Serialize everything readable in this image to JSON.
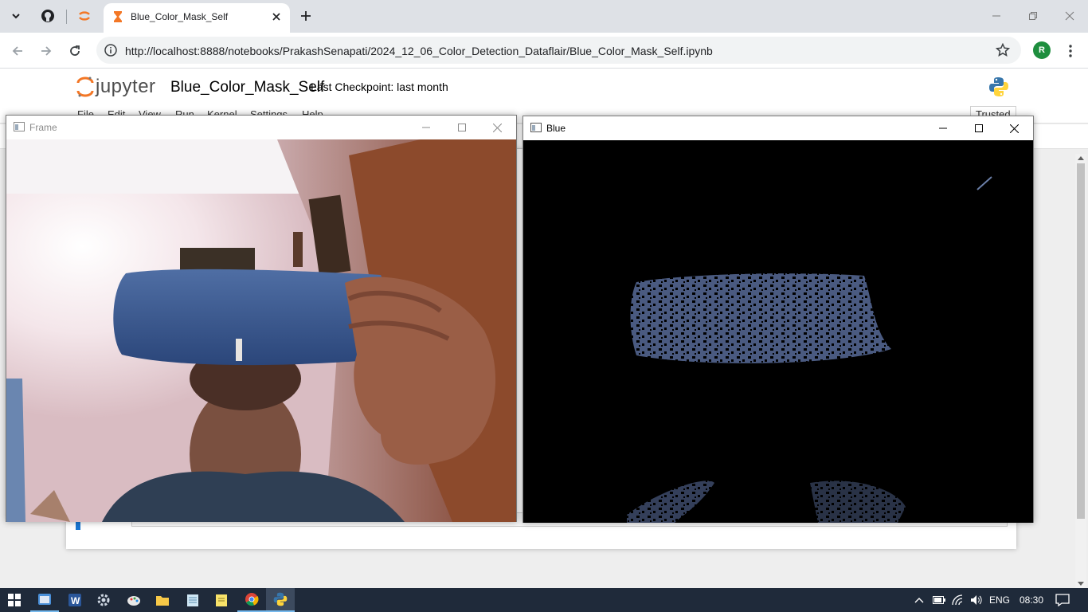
{
  "browser": {
    "active_tab_title": "Blue_Color_Mask_Self",
    "url": "http://localhost:8888/notebooks/PrakashSenapati/2024_12_06_Color_Detection_Dataflair/Blue_Color_Mask_Self.ipynb",
    "profile_initial": "R"
  },
  "jupyter": {
    "logo_text": "jupyter",
    "notebook_name": "Blue_Color_Mask_Self",
    "checkpoint": "Last Checkpoint: last month",
    "menu": [
      "File",
      "Edit",
      "View",
      "Run",
      "Kernel",
      "Settings",
      "Help"
    ],
    "trusted_label": "Trusted"
  },
  "windows": {
    "frame": {
      "title": "Frame"
    },
    "blue": {
      "title": "Blue"
    }
  },
  "taskbar": {
    "language": "ENG",
    "time": "08:30",
    "apps": [
      "file-explorer-pinned",
      "word",
      "settings",
      "paint",
      "file-explorer",
      "notepad",
      "sticky-notes",
      "chrome",
      "python"
    ]
  },
  "colors": {
    "jupyter_orange": "#f37726",
    "taskbar_bg": "#1f2a3a",
    "accent_blue": "#1976d2"
  }
}
